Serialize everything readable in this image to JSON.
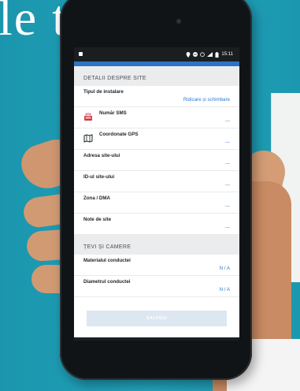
{
  "background": {
    "title_text": "le t",
    "color": "#1f9bb2"
  },
  "statusbar": {
    "time": "15:11",
    "icons": [
      "location-icon",
      "minus-circle-icon",
      "alarm-icon",
      "signal-icon",
      "battery-icon"
    ]
  },
  "sections": [
    {
      "header": "DETALII DESPRE SITE",
      "rows": [
        {
          "label": "Tipul de instalare",
          "value": "Ridicare și schimbare"
        },
        {
          "label": "Număr SMS",
          "value": "---",
          "icon": "sms-device-icon"
        },
        {
          "label": "Coordonate GPS",
          "value": "---",
          "icon": "map-icon"
        },
        {
          "label": "Adresa site-ului",
          "value": "---"
        },
        {
          "label": "ID-ul site-ului",
          "value": "---"
        },
        {
          "label": "Zona / DMA",
          "value": "---"
        },
        {
          "label": "Note de site",
          "value": "---"
        }
      ]
    },
    {
      "header": "ȚEVI ȘI CAMERE",
      "rows": [
        {
          "label": "Materialul conductei",
          "value": "N / A"
        },
        {
          "label": "Diametrul conductei",
          "value": "N / A"
        }
      ]
    }
  ],
  "save_button": {
    "label": "SALVEZI"
  },
  "colors": {
    "accent": "#2f7ad0",
    "appbar": "#2c74c5",
    "section_bg": "#ebecee",
    "button_bg": "#dde7f2"
  }
}
